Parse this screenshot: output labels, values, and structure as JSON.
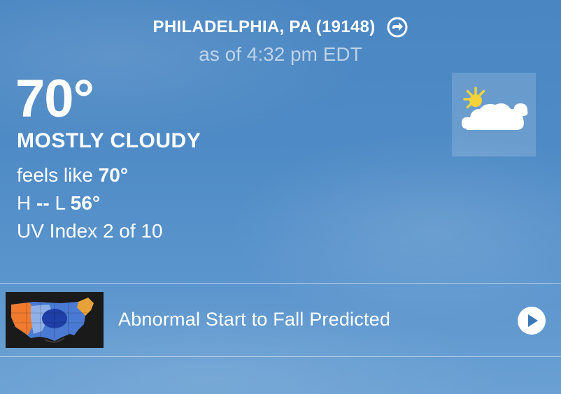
{
  "location": {
    "name": "PHILADELPHIA, PA (19148)",
    "arrow_icon": "arrow-right-circle-icon"
  },
  "as_of": "as of 4:32 pm EDT",
  "current": {
    "temperature": "70°",
    "condition": "MOSTLY CLOUDY",
    "feels_like_label": "feels like",
    "feels_like_value": "70°",
    "high_label": "H",
    "high_value": "--",
    "low_label": "L",
    "low_value": "56°",
    "uv_index": "UV Index 2 of 10",
    "icon": "partly-cloudy-icon"
  },
  "news": {
    "headline": "Abnormal Start to Fall Predicted",
    "thumbnail_icon": "us-temperature-map-thumbnail",
    "play_icon": "play-icon"
  },
  "colors": {
    "background": "#4f8bc6",
    "sun": "#f5d23a",
    "text": "#ffffff"
  }
}
